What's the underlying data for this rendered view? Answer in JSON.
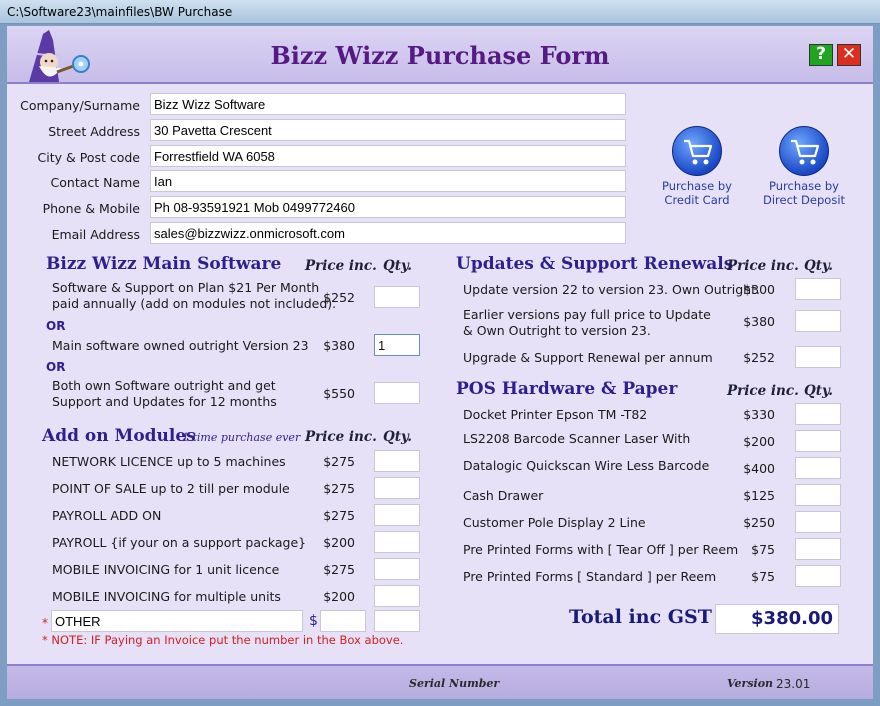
{
  "window": {
    "title": "C:\\Software23\\mainfiles\\BW Purchase"
  },
  "header": {
    "title": "Bizz Wizz Purchase Form",
    "help_label": "?",
    "close_label": "✕"
  },
  "contact": {
    "fields": [
      {
        "label": "Company/Surname",
        "value": "Bizz Wizz Software"
      },
      {
        "label": "Street Address",
        "value": "30 Pavetta Crescent"
      },
      {
        "label": "City & Post code",
        "value": "Forrestfield  WA  6058"
      },
      {
        "label": "Contact Name",
        "value": "Ian"
      },
      {
        "label": "Phone & Mobile",
        "value": "Ph 08-93591921  Mob 0499772460"
      },
      {
        "label": "Email Address",
        "value": "sales@bizzwizz.onmicrosoft.com"
      }
    ]
  },
  "purchase_buttons": {
    "credit_card": {
      "line1": "Purchase by",
      "line2": "Credit Card"
    },
    "direct_deposit": {
      "line1": "Purchase by",
      "line2": "Direct Deposit"
    }
  },
  "main_software": {
    "title": "Bizz Wizz Main Software",
    "price_header": "Price inc.",
    "qty_header": "Qty.",
    "or_label": "OR",
    "items": [
      {
        "line1": "Software & Support on Plan $21 Per Month",
        "line2": "paid annually (add on modules not included).",
        "price": "$252",
        "qty": ""
      },
      {
        "line1": "Main software owned outright  Version 23",
        "line2": "",
        "price": "$380",
        "qty": "1"
      },
      {
        "line1": "Both own Software outright and get",
        "line2": "Support and Updates for 12 months",
        "price": "$550",
        "qty": ""
      }
    ]
  },
  "add_on_modules": {
    "title": "Add on Modules",
    "subtitle": "1 time purchase ever",
    "price_header": "Price inc.",
    "qty_header": "Qty.",
    "items": [
      {
        "label": "NETWORK LICENCE up to 5 machines",
        "price": "$275",
        "qty": ""
      },
      {
        "label": "POINT OF SALE  up to 2 till per module",
        "price": "$275",
        "qty": ""
      },
      {
        "label": "PAYROLL ADD ON",
        "price": "$275",
        "qty": ""
      },
      {
        "label": "PAYROLL {if your on a support package}",
        "price": "$200",
        "qty": ""
      },
      {
        "label": "MOBILE INVOICING for 1 unit licence",
        "price": "$275",
        "qty": ""
      },
      {
        "label": "MOBILE INVOICING for multiple units",
        "price": "$200",
        "qty": ""
      }
    ],
    "other": {
      "star": "*",
      "value": "OTHER",
      "dollar": "$",
      "amount": "",
      "qty": ""
    },
    "note": "*  NOTE: IF Paying an Invoice put the number in the Box above."
  },
  "updates": {
    "title": "Updates & Support Renewals",
    "price_header": "Price inc.",
    "qty_header": "Qty.",
    "items": [
      {
        "line1": "Update version 22 to version 23. Own Outright.",
        "line2": "",
        "price": "$300",
        "qty": ""
      },
      {
        "line1": "Earlier versions pay full price to Update",
        "line2": "& Own Outright to version 23.",
        "price": "$380",
        "qty": ""
      },
      {
        "line1": "Upgrade & Support Renewal  per annum",
        "line2": "",
        "price": "$252",
        "qty": ""
      }
    ]
  },
  "pos_hardware": {
    "title": "POS Hardware & Paper",
    "price_header": "Price inc.",
    "qty_header": "Qty.",
    "items": [
      {
        "label": "Docket Printer Epson TM -T82",
        "price": "$330",
        "qty": ""
      },
      {
        "label": "LS2208 Barcode Scanner Laser With",
        "price": "$200",
        "qty": ""
      },
      {
        "label": "Datalogic Quickscan Wire Less Barcode",
        "price": "$400",
        "qty": ""
      },
      {
        "label": "Cash Drawer",
        "price": "$125",
        "qty": ""
      },
      {
        "label": "Customer Pole Display 2 Line",
        "price": "$250",
        "qty": ""
      },
      {
        "label": "Pre Printed Forms with [ Tear Off ] per Reem",
        "price": "$75",
        "qty": ""
      },
      {
        "label": "Pre Printed Forms [ Standard ] per Reem",
        "price": "$75",
        "qty": ""
      }
    ]
  },
  "total": {
    "label": "Total inc GST",
    "value": "$380.00"
  },
  "footer": {
    "serial_label": "Serial Number",
    "version_label": "Version",
    "version_value": "23.01"
  },
  "colors": {
    "accent": "#561b83",
    "section": "#2d1f8e",
    "panel": "#e6e1f7",
    "note": "#d42020"
  }
}
